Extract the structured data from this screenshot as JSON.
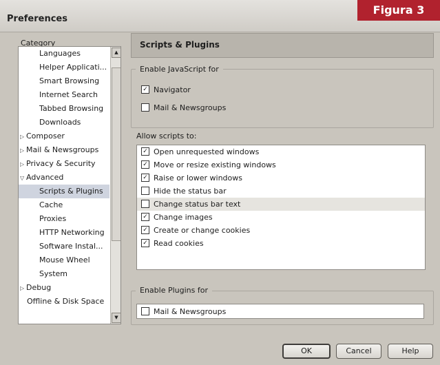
{
  "window": {
    "title": "Preferences"
  },
  "figure_label": "Figura 3",
  "category": {
    "label": "Category",
    "items": [
      {
        "label": "Languages",
        "kind": "child"
      },
      {
        "label": "Helper Applicati...",
        "kind": "child"
      },
      {
        "label": "Smart Browsing",
        "kind": "child"
      },
      {
        "label": "Internet Search",
        "kind": "child"
      },
      {
        "label": "Tabbed Browsing",
        "kind": "child"
      },
      {
        "label": "Downloads",
        "kind": "child"
      },
      {
        "label": "Composer",
        "kind": "parent",
        "expanded": false
      },
      {
        "label": "Mail & Newsgroups",
        "kind": "parent",
        "expanded": false
      },
      {
        "label": "Privacy & Security",
        "kind": "parent",
        "expanded": false
      },
      {
        "label": "Advanced",
        "kind": "parent",
        "expanded": true
      },
      {
        "label": "Scripts & Plugins",
        "kind": "child",
        "selected": true
      },
      {
        "label": "Cache",
        "kind": "child"
      },
      {
        "label": "Proxies",
        "kind": "child"
      },
      {
        "label": "HTTP Networking",
        "kind": "child"
      },
      {
        "label": "Software Instal...",
        "kind": "child"
      },
      {
        "label": "Mouse Wheel",
        "kind": "child"
      },
      {
        "label": "System",
        "kind": "child"
      },
      {
        "label": "Debug",
        "kind": "parent",
        "expanded": false
      },
      {
        "label": "Offline & Disk Space",
        "kind": "plain"
      }
    ]
  },
  "panel": {
    "title": "Scripts & Plugins",
    "enable_js": {
      "title": "Enable JavaScript for",
      "navigator": {
        "label": "Navigator",
        "checked": true
      },
      "mail": {
        "label": "Mail & Newsgroups",
        "checked": false
      }
    },
    "allow_scripts": {
      "title": "Allow scripts to:",
      "items": [
        {
          "label": "Open unrequested windows",
          "checked": true
        },
        {
          "label": "Move or resize existing windows",
          "checked": true
        },
        {
          "label": "Raise or lower windows",
          "checked": true
        },
        {
          "label": "Hide the status bar",
          "checked": false
        },
        {
          "label": "Change status bar text",
          "checked": false
        },
        {
          "label": "Change images",
          "checked": true
        },
        {
          "label": "Create or change cookies",
          "checked": true
        },
        {
          "label": "Read cookies",
          "checked": true
        }
      ]
    },
    "plugins": {
      "title": "Enable Plugins for",
      "mail": {
        "label": "Mail & Newsgroups",
        "checked": false
      }
    }
  },
  "buttons": {
    "ok": "OK",
    "cancel": "Cancel",
    "help": "Help"
  },
  "colors": {
    "figure_badge": "#b1222e",
    "selection": "#cfd4df"
  }
}
